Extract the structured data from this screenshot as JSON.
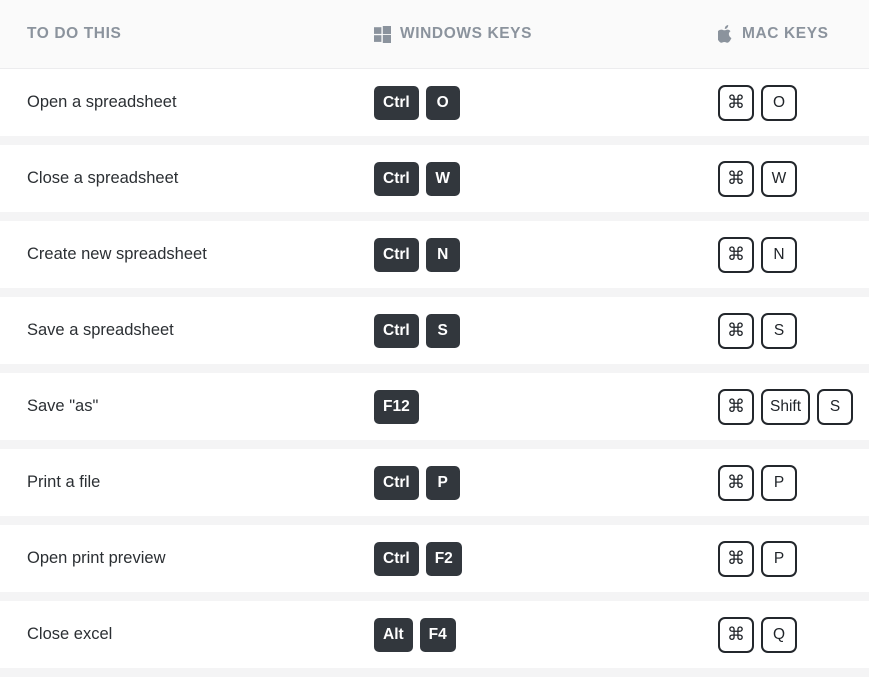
{
  "header": {
    "task_label": "TO DO THIS",
    "windows_label": "WINDOWS KEYS",
    "mac_label": "MAC KEYS",
    "windows_icon": "windows-logo-icon",
    "mac_icon": "apple-logo-icon",
    "header_text_color": "#8b939d",
    "header_bg_color": "#fafafa"
  },
  "theme": {
    "win_key_bg": "#32373d",
    "win_key_text": "#ffffff",
    "mac_key_border": "#23272c",
    "mac_key_text": "#1f2328",
    "row_bg": "#ffffff",
    "row_separator": "#f4f4f5",
    "task_text_color": "#2b2f33"
  },
  "rows": [
    {
      "task": "Open a spreadsheet",
      "windows_keys": [
        "Ctrl",
        "O"
      ],
      "mac_keys": [
        "⌘",
        "O"
      ]
    },
    {
      "task": "Close a spreadsheet",
      "windows_keys": [
        "Ctrl",
        "W"
      ],
      "mac_keys": [
        "⌘",
        "W"
      ]
    },
    {
      "task": "Create new spreadsheet",
      "windows_keys": [
        "Ctrl",
        "N"
      ],
      "mac_keys": [
        "⌘",
        "N"
      ]
    },
    {
      "task": "Save a spreadsheet",
      "windows_keys": [
        "Ctrl",
        "S"
      ],
      "mac_keys": [
        "⌘",
        "S"
      ]
    },
    {
      "task": "Save \"as\"",
      "windows_keys": [
        "F12"
      ],
      "mac_keys": [
        "⌘",
        "Shift",
        "S"
      ]
    },
    {
      "task": "Print a file",
      "windows_keys": [
        "Ctrl",
        "P"
      ],
      "mac_keys": [
        "⌘",
        "P"
      ]
    },
    {
      "task": "Open print preview",
      "windows_keys": [
        "Ctrl",
        "F2"
      ],
      "mac_keys": [
        "⌘",
        "P"
      ]
    },
    {
      "task": "Close excel",
      "windows_keys": [
        "Alt",
        "F4"
      ],
      "mac_keys": [
        "⌘",
        "Q"
      ]
    }
  ]
}
